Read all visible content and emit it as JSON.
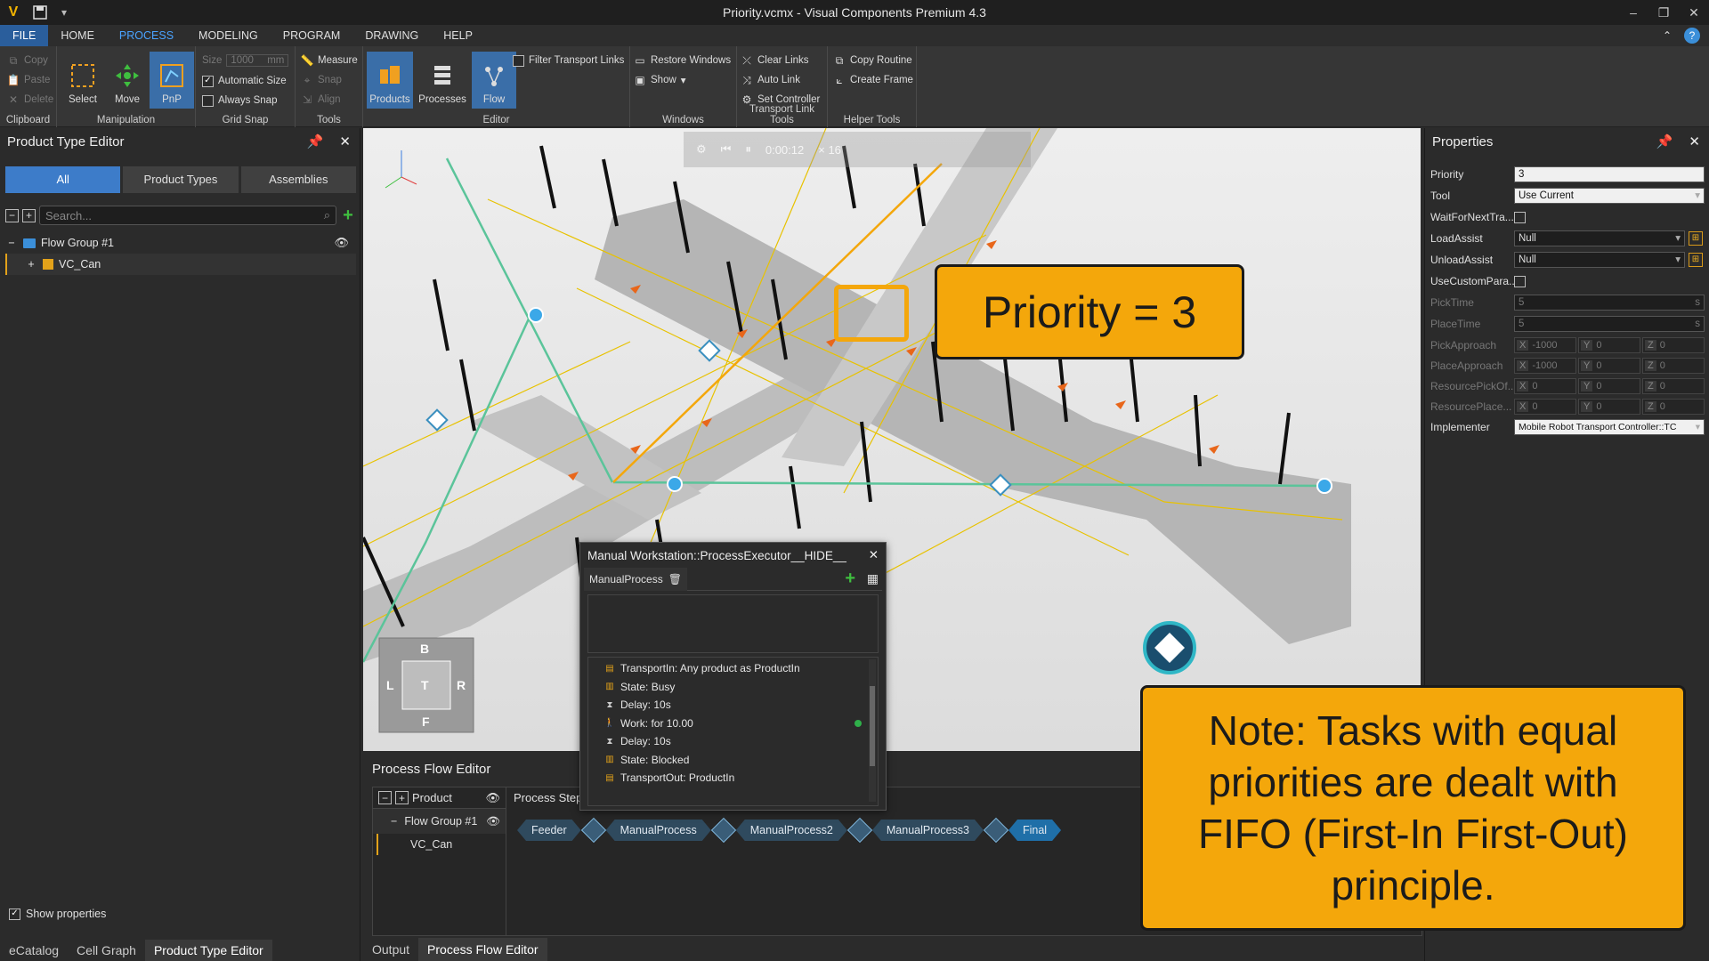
{
  "window": {
    "title": "Priority.vcmx - Visual Components Premium 4.3",
    "logo": "V",
    "help": "?"
  },
  "menu": {
    "tabs": [
      "FILE",
      "HOME",
      "PROCESS",
      "MODELING",
      "PROGRAM",
      "DRAWING",
      "HELP"
    ],
    "active": "PROCESS"
  },
  "ribbon": {
    "clipboard": {
      "label": "Clipboard",
      "copy": "Copy",
      "paste": "Paste",
      "delete": "Delete"
    },
    "manipulation": {
      "label": "Manipulation",
      "select": "Select",
      "move": "Move",
      "pnp": "PnP"
    },
    "gridsnap": {
      "label": "Grid Snap",
      "size_label": "Size",
      "size_value": "1000",
      "size_unit": "mm",
      "automatic_size": "Automatic Size",
      "always_snap": "Always Snap"
    },
    "tools": {
      "label": "Tools",
      "measure": "Measure",
      "snap": "Snap",
      "align": "Align"
    },
    "editor": {
      "label": "Editor",
      "products": "Products",
      "processes": "Processes",
      "flow": "Flow",
      "filter": "Filter Transport Links"
    },
    "windows": {
      "label": "Windows",
      "restore": "Restore Windows",
      "show": "Show"
    },
    "transport": {
      "label": "Transport Link Tools",
      "clear": "Clear Links",
      "auto": "Auto Link",
      "set": "Set Controller"
    },
    "helper": {
      "label": "Helper Tools",
      "copy_routine": "Copy Routine",
      "create_frame": "Create Frame"
    }
  },
  "left_panel": {
    "title": "Product Type Editor",
    "segments": [
      "All",
      "Product Types",
      "Assemblies"
    ],
    "search_placeholder": "Search...",
    "tree": [
      {
        "label": "Flow Group #1",
        "toggle": "−"
      },
      {
        "label": "VC_Can",
        "toggle": "+"
      }
    ],
    "show_properties": "Show properties",
    "bottom_tabs": [
      "eCatalog",
      "Cell Graph",
      "Product Type Editor"
    ]
  },
  "viewport": {
    "sim_time": "0:00:12",
    "speed": "× 16",
    "nav": {
      "top": "B",
      "left": "L",
      "center": "T",
      "right": "R",
      "bottom": "F"
    }
  },
  "callouts": {
    "priority": "Priority = 3",
    "note": "Note: Tasks with equal priorities are dealt with FIFO (First-In First-Out) principle."
  },
  "properties": {
    "title": "Properties",
    "rows": [
      {
        "label": "Priority",
        "value": "3"
      },
      {
        "label": "Tool",
        "value": "Use Current"
      },
      {
        "label": "WaitForNextTra...",
        "value": ""
      },
      {
        "label": "LoadAssist",
        "value": "Null"
      },
      {
        "label": "UnloadAssist",
        "value": "Null"
      },
      {
        "label": "UseCustomPara...",
        "value": ""
      },
      {
        "label": "PickTime",
        "value": "5"
      },
      {
        "label": "PlaceTime",
        "value": "5"
      },
      {
        "label": "PickApproach",
        "x": "-1000",
        "y": "0",
        "z": "0"
      },
      {
        "label": "PlaceApproach",
        "x": "-1000",
        "y": "0",
        "z": "0"
      },
      {
        "label": "ResourcePickOf...",
        "x": "0",
        "y": "0",
        "z": "0"
      },
      {
        "label": "ResourcePlace...",
        "x": "0",
        "y": "0",
        "z": "0"
      },
      {
        "label": "Implementer",
        "value": "Mobile Robot Transport Controller::TC"
      }
    ],
    "time_unit": "s"
  },
  "process_flow_editor": {
    "title": "Process Flow Editor",
    "col_product": "Product",
    "col_steps": "Process Step",
    "group": "Flow Group #1",
    "product": "VC_Can",
    "steps": [
      "Feeder",
      "ManualProcess",
      "ManualProcess2",
      "ManualProcess3",
      "Final"
    ],
    "tabs": [
      "Output",
      "Process Flow Editor"
    ]
  },
  "popup": {
    "title": "Manual Workstation::ProcessExecutor__HIDE__",
    "tab": "ManualProcess",
    "items": [
      "TransportIn: Any product as ProductIn",
      "State: Busy",
      "Delay: 10s",
      "Work: for 10.00",
      "Delay: 10s",
      "State: Blocked",
      "TransportOut: ProductIn"
    ]
  },
  "colors": {
    "accent": "#3d7cc9",
    "callout": "#f4a70b",
    "link": "#5bc49a",
    "active_flow": "#f4a70b"
  }
}
